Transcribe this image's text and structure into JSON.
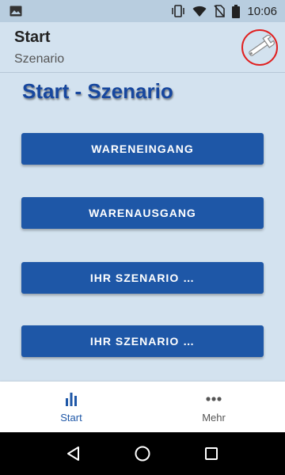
{
  "status_bar": {
    "time": "10:06",
    "icons": [
      "image-icon",
      "vibrate-icon",
      "wifi-icon",
      "no-sim-icon",
      "battery-icon"
    ]
  },
  "app_bar": {
    "title": "Start",
    "subtitle": "Szenario",
    "action_icon": "wrench-icon",
    "highlight_color": "#e02020"
  },
  "main": {
    "heading": "Start - Szenario",
    "buttons": [
      {
        "label": "WARENEINGANG"
      },
      {
        "label": "WARENAUSGANG"
      },
      {
        "label": "IHR SZENARIO …"
      },
      {
        "label": "IHR SZENARIO …"
      }
    ]
  },
  "bottom_nav": {
    "items": [
      {
        "label": "Start",
        "icon": "bar-chart-icon",
        "active": true
      },
      {
        "label": "Mehr",
        "icon": "more-dots-icon",
        "active": false
      }
    ]
  },
  "system_nav": {
    "icons": [
      "back-icon",
      "home-icon",
      "recents-icon"
    ]
  },
  "colors": {
    "accent": "#1e57a7",
    "background": "#d3e2ef",
    "status_bar": "#b8cddf"
  }
}
